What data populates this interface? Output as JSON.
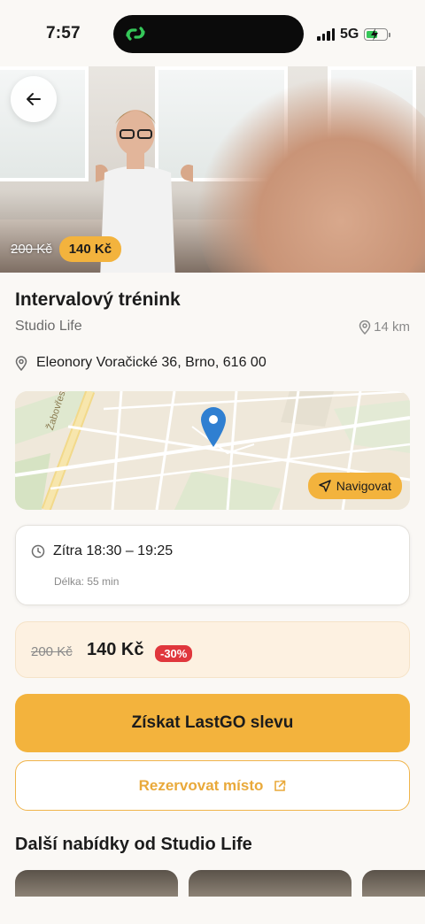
{
  "status_bar": {
    "time": "7:57",
    "network": "5G"
  },
  "hero": {
    "old_price": "200 Kč",
    "new_price": "140 Kč"
  },
  "event": {
    "title": "Intervalový trénink",
    "studio": "Studio Life",
    "distance": "14 km",
    "address": "Eleonory Voračické 36, Brno, 616 00"
  },
  "map": {
    "street_label": "Žabovřeská",
    "navigate_label": "Navigovat"
  },
  "schedule": {
    "time": "Zítra 18:30 – 19:25",
    "duration": "Délka: 55 min"
  },
  "pricing": {
    "old_price": "200 Kč",
    "new_price": "140 Kč",
    "discount": "-30%"
  },
  "actions": {
    "primary_label": "Získat LastGO slevu",
    "secondary_label": "Rezervovat místo"
  },
  "more_offers": {
    "title": "Další nabídky od Studio Life"
  },
  "colors": {
    "accent": "#f3b33d",
    "discount": "#e0373d",
    "background": "#faf8f5"
  }
}
